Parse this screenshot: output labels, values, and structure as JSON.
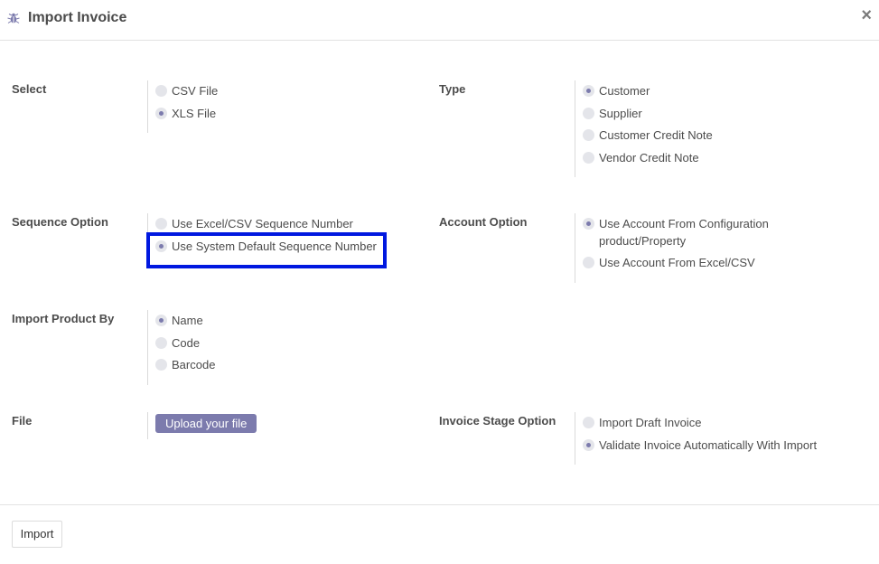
{
  "header": {
    "title": "Import Invoice",
    "icon": "bug-icon",
    "close": "×"
  },
  "select": {
    "label": "Select",
    "options": [
      {
        "label": "CSV File",
        "selected": false
      },
      {
        "label": "XLS File",
        "selected": true
      }
    ]
  },
  "type": {
    "label": "Type",
    "options": [
      {
        "label": "Customer",
        "selected": true
      },
      {
        "label": "Supplier",
        "selected": false
      },
      {
        "label": "Customer Credit Note",
        "selected": false
      },
      {
        "label": "Vendor Credit Note",
        "selected": false
      }
    ]
  },
  "sequence": {
    "label": "Sequence Option",
    "options": [
      {
        "label": "Use Excel/CSV Sequence Number",
        "selected": false
      },
      {
        "label": "Use System Default Sequence Number",
        "selected": true
      }
    ]
  },
  "account": {
    "label": "Account Option",
    "options": [
      {
        "label": "Use Account From Configuration",
        "label_line2": "product/Property",
        "selected": true
      },
      {
        "label": "Use Account From Excel/CSV",
        "selected": false
      }
    ]
  },
  "product": {
    "label": "Import Product By",
    "options": [
      {
        "label": "Name",
        "selected": true
      },
      {
        "label": "Code",
        "selected": false
      },
      {
        "label": "Barcode",
        "selected": false
      }
    ]
  },
  "file": {
    "label": "File",
    "upload_label": "Upload your file"
  },
  "stage": {
    "label": "Invoice Stage Option",
    "options": [
      {
        "label": "Import Draft Invoice",
        "selected": false
      },
      {
        "label": "Validate Invoice Automatically With Import",
        "selected": true
      }
    ]
  },
  "footer": {
    "import_label": "Import"
  },
  "colors": {
    "accent": "#7c7bad",
    "highlight": "#0018e0"
  }
}
